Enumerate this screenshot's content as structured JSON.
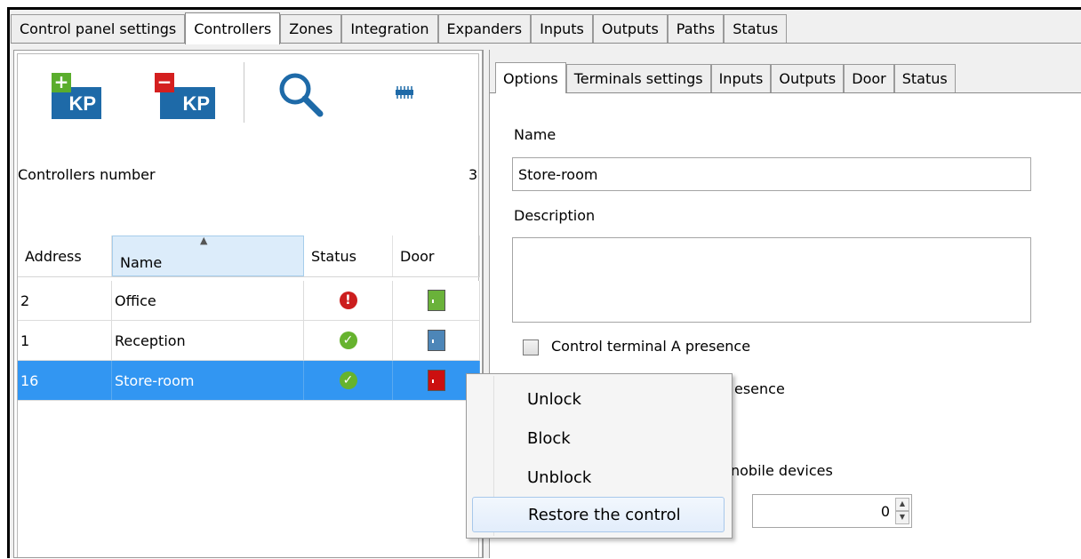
{
  "top_tabs": [
    "Control panel settings",
    "Controllers",
    "Zones",
    "Integration",
    "Expanders",
    "Inputs",
    "Outputs",
    "Paths",
    "Status"
  ],
  "active_top_tab": "Controllers",
  "toolbar": {
    "add_label": "KP",
    "remove_label": "KP",
    "icons": [
      "add-keypad-icon",
      "remove-keypad-icon",
      "search-icon",
      "module-icon"
    ]
  },
  "controllers": {
    "count_label": "Controllers number",
    "count_value": "3",
    "columns": [
      "Address",
      "Name",
      "Status",
      "Door"
    ],
    "rows": [
      {
        "address": "2",
        "name": "Office",
        "status": "error",
        "door": "green"
      },
      {
        "address": "1",
        "name": "Reception",
        "status": "ok",
        "door": "blue"
      },
      {
        "address": "16",
        "name": "Store-room",
        "status": "ok",
        "door": "red"
      }
    ]
  },
  "sub_tabs": [
    "Options",
    "Terminals settings",
    "Inputs",
    "Outputs",
    "Door",
    "Status"
  ],
  "form": {
    "name_label": "Name",
    "name_value": "Store-room",
    "description_label": "Description",
    "description_value": "",
    "terminal_a_label": "Control terminal A presence",
    "terminal_b_fragment": "esence",
    "mobile_fragment": "nobile devices",
    "spinner_value": "0"
  },
  "context_menu": [
    "Unlock",
    "Block",
    "Unblock",
    "Restore the control"
  ],
  "colors": {
    "selection": "#3296f2",
    "status_error": "#cc1e1e",
    "status_ok": "#66b32e",
    "door_green": "#6ab23a",
    "door_blue": "#4d86b8",
    "door_red": "#cc1010",
    "kp_blue": "#1e6aa8"
  }
}
